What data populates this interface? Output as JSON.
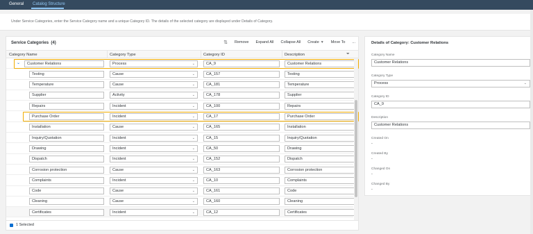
{
  "tabs": [
    "General",
    "Catalog Structure"
  ],
  "info_text": "Under Service Categories, enter the Service Category name and a unique Category ID. The details of the selected category are displayed under Details of Category.",
  "table": {
    "title": "Service Categories",
    "count": "(4)",
    "toolbar": {
      "sort_icon": "sort-icon",
      "remove": "Remove",
      "expand_all": "Expand All",
      "collapse_all": "Collapse All",
      "create": "Create",
      "move_to": "Move To",
      "more": "..."
    },
    "columns": [
      "Category Name",
      "Category Type",
      "Category ID",
      "Description"
    ],
    "rows": [
      {
        "name": "Customer Relations",
        "type": "Process",
        "id": "CA_9",
        "desc": "Customer Relations"
      },
      {
        "name": "Testing",
        "type": "Cause",
        "id": "CA_157",
        "desc": "Testing"
      },
      {
        "name": "Temperature",
        "type": "Cause",
        "id": "CA_181",
        "desc": "Temperature"
      },
      {
        "name": "Supplier",
        "type": "Activity",
        "id": "CA_178",
        "desc": "Supplier"
      },
      {
        "name": "Repairs",
        "type": "Incident",
        "id": "CA_100",
        "desc": "Repairs"
      },
      {
        "name": "Purchase Order",
        "type": "Incident",
        "id": "CA_17",
        "desc": "Purchase Order"
      },
      {
        "name": "Installation",
        "type": "Cause",
        "id": "CA_165",
        "desc": "Installation"
      },
      {
        "name": "Inquiry/Quotation",
        "type": "Incident",
        "id": "CA_15",
        "desc": "Inquiry/Quotation"
      },
      {
        "name": "Drawing",
        "type": "Incident",
        "id": "CA_50",
        "desc": "Drawing"
      },
      {
        "name": "Dispatch",
        "type": "Incident",
        "id": "CA_152",
        "desc": "Dispatch"
      },
      {
        "name": "Corrosion protection",
        "type": "Cause",
        "id": "CA_163",
        "desc": "Corrosion protection"
      },
      {
        "name": "Complaints",
        "type": "Incident",
        "id": "CA_10",
        "desc": "Complaints"
      },
      {
        "name": "Code",
        "type": "Cause",
        "id": "CA_161",
        "desc": "Code"
      },
      {
        "name": "Cleaning",
        "type": "Cause",
        "id": "CA_160",
        "desc": "Cleaning"
      },
      {
        "name": "Certificates",
        "type": "Incident",
        "id": "CA_12",
        "desc": "Certificates"
      }
    ],
    "footer": "1 Selected"
  },
  "details": {
    "title": "Details of Category: Customer Relations",
    "category_name_label": "Category Name",
    "category_name": "Customer Relations",
    "category_type_label": "Category Type",
    "category_type": "Process",
    "category_id_label": "Category ID",
    "category_id": "CA_9",
    "description_label": "Description",
    "description": "Customer Relations",
    "created_on_label": "Created On",
    "created_on": "-",
    "created_by_label": "Created By",
    "created_by": "-",
    "changed_on_label": "Changed On",
    "changed_on": "-",
    "changed_by_label": "Changed By",
    "changed_by": "-"
  },
  "colors": {
    "shell": "#354a5f",
    "accent": "#0a6ed1",
    "highlight": "#f0ab00"
  }
}
